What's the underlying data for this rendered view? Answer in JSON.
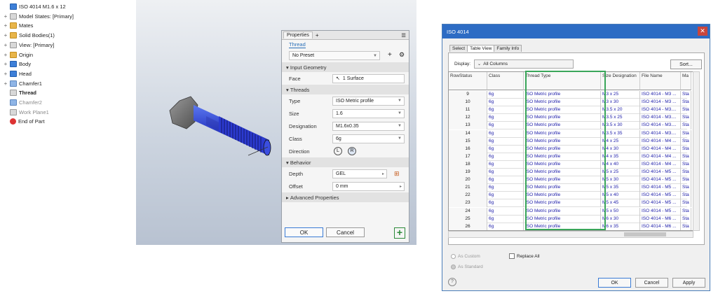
{
  "tree": {
    "items": [
      {
        "label": "ISO 4014 M1.6 x 12",
        "icon": "part-icon",
        "expander": ""
      },
      {
        "label": "Model States: [Primary]",
        "icon": "model-states-icon",
        "expander": "+"
      },
      {
        "label": "Mates",
        "icon": "folder-icon",
        "expander": "+"
      },
      {
        "label": "Solid Bodies(1)",
        "icon": "folder-icon",
        "expander": "+"
      },
      {
        "label": "View: [Primary]",
        "icon": "view-icon",
        "expander": "+"
      },
      {
        "label": "Origin",
        "icon": "folder-icon",
        "expander": "+"
      },
      {
        "label": "Body",
        "icon": "extrude-icon",
        "expander": "+"
      },
      {
        "label": "Head",
        "icon": "extrude-icon",
        "expander": "+"
      },
      {
        "label": "Chamfer1",
        "icon": "chamfer-icon",
        "expander": "+"
      },
      {
        "label": "Thread",
        "icon": "thread-icon",
        "expander": ""
      },
      {
        "label": "Chamfer2",
        "icon": "chamfer-icon",
        "expander": ""
      },
      {
        "label": "Work Plane1",
        "icon": "work-plane-icon",
        "expander": ""
      },
      {
        "label": "End of Part",
        "icon": "end-of-part-icon",
        "expander": ""
      }
    ]
  },
  "properties": {
    "tabs": [
      "Properties",
      "+"
    ],
    "feature_tab": "Thread",
    "preset": "No Preset",
    "sections": {
      "input_geometry": "Input Geometry",
      "threads": "Threads",
      "behavior": "Behavior",
      "advanced": "Advanced Properties"
    },
    "face_label": "Face",
    "face_value": "1 Surface",
    "type_label": "Type",
    "type_value": "ISO Metric profile",
    "size_label": "Size",
    "size_value": "1.6",
    "designation_label": "Designation",
    "designation_value": "M1.6x0.35",
    "class_label": "Class",
    "class_value": "6g",
    "direction_label": "Direction",
    "depth_label": "Depth",
    "depth_value": "GEL",
    "offset_label": "Offset",
    "offset_value": "0 mm",
    "ok": "OK",
    "cancel": "Cancel"
  },
  "dialog": {
    "title": "ISO 4014",
    "tabs": [
      "Select",
      "Table View",
      "Family Info"
    ],
    "display_label": "Display:",
    "display_value": "All Columns",
    "sort_button": "Sort...",
    "columns": [
      "RowStatus",
      "Class",
      "Thread Type",
      "Size Designation",
      "File Name",
      "Ma"
    ],
    "rows": [
      [
        "9",
        "6g",
        "ISO Metric profile",
        "M3 x 25",
        "ISO 4014 - M3 ...",
        "Sta"
      ],
      [
        "10",
        "6g",
        "ISO Metric profile",
        "M3 x 30",
        "ISO 4014 - M3 ...",
        "Sta"
      ],
      [
        "11",
        "6g",
        "ISO Metric profile",
        "M3.5 x 20",
        "ISO 4014 - M3....",
        "Sta"
      ],
      [
        "12",
        "6g",
        "ISO Metric profile",
        "M3.5 x 25",
        "ISO 4014 - M3....",
        "Sta"
      ],
      [
        "13",
        "6g",
        "ISO Metric profile",
        "M3.5 x 30",
        "ISO 4014 - M3....",
        "Sta"
      ],
      [
        "14",
        "6g",
        "ISO Metric profile",
        "M3.5 x 35",
        "ISO 4014 - M3....",
        "Sta"
      ],
      [
        "15",
        "6g",
        "ISO Metric profile",
        "M4 x 25",
        "ISO 4014 - M4 ...",
        "Sta"
      ],
      [
        "16",
        "6g",
        "ISO Metric profile",
        "M4 x 30",
        "ISO 4014 - M4 ...",
        "Sta"
      ],
      [
        "17",
        "6g",
        "ISO Metric profile",
        "M4 x 35",
        "ISO 4014 - M4 ...",
        "Sta"
      ],
      [
        "18",
        "6g",
        "ISO Metric profile",
        "M4 x 40",
        "ISO 4014 - M4 ...",
        "Sta"
      ],
      [
        "19",
        "6g",
        "ISO Metric profile",
        "M5 x 25",
        "ISO 4014 - M5 ...",
        "Sta"
      ],
      [
        "20",
        "6g",
        "ISO Metric profile",
        "M5 x 30",
        "ISO 4014 - M5 ...",
        "Sta"
      ],
      [
        "21",
        "6g",
        "ISO Metric profile",
        "M5 x 35",
        "ISO 4014 - M5 ...",
        "Sta"
      ],
      [
        "22",
        "6g",
        "ISO Metric profile",
        "M5 x 40",
        "ISO 4014 - M5 ...",
        "Sta"
      ],
      [
        "23",
        "6g",
        "ISO Metric profile",
        "M5 x 45",
        "ISO 4014 - M5 ...",
        "Sta"
      ],
      [
        "24",
        "6g",
        "ISO Metric profile",
        "M5 x 50",
        "ISO 4014 - M5 ...",
        "Sta"
      ],
      [
        "25",
        "6g",
        "ISO Metric profile",
        "M6 x 30",
        "ISO 4014 - M6 ...",
        "Sta"
      ],
      [
        "26",
        "6g",
        "ISO Metric profile",
        "M6 x 35",
        "ISO 4014 - M6 ...",
        "Sta"
      ]
    ],
    "as_custom": "As Custom",
    "as_standard": "As Standard",
    "replace_all": "Replace All",
    "ok": "OK",
    "cancel": "Cancel",
    "apply": "Apply",
    "colors": {
      "titlebar": "#2d6cc4",
      "highlight": "#3aa65a",
      "cell_text": "#1a1aa8"
    }
  }
}
